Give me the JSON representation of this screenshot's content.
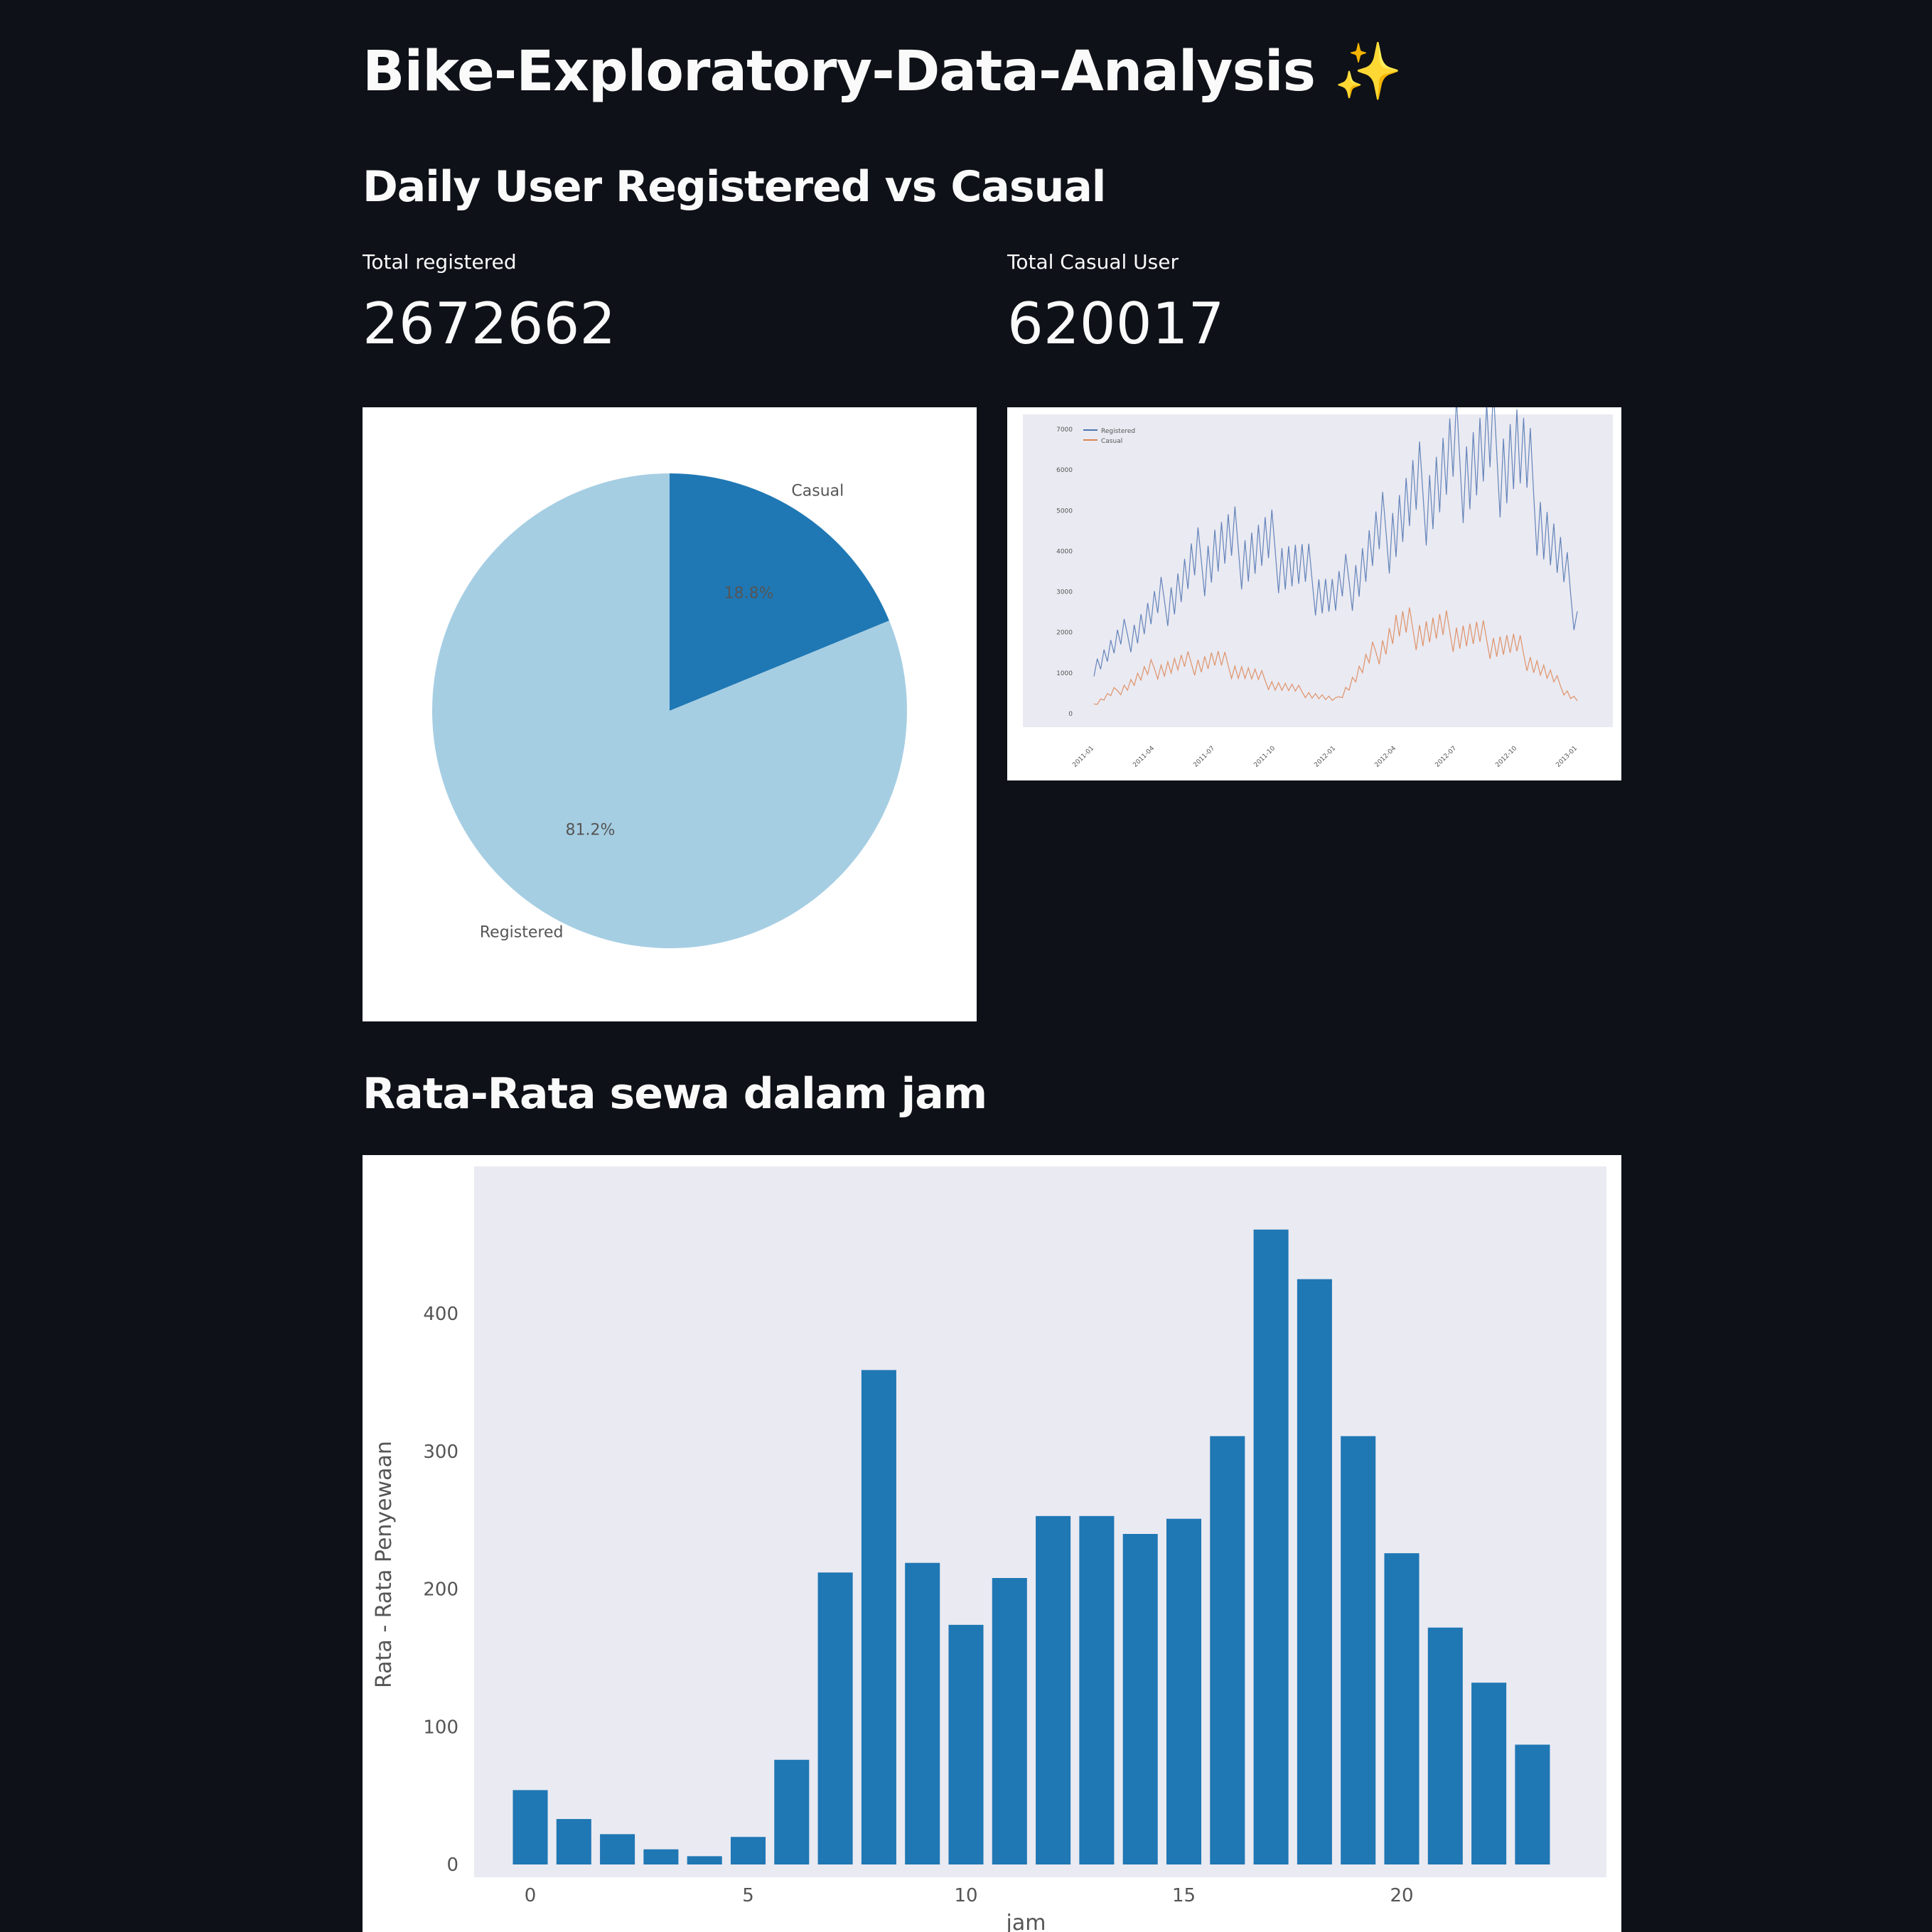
{
  "header": {
    "title": "Bike-Exploratory-Data-Analysis",
    "title_icon": "sparkles-icon",
    "sparkle_glyph": "✨"
  },
  "section_daily": {
    "heading": "Daily User Registered vs Casual"
  },
  "metrics": [
    {
      "label": "Total registered",
      "value": "2672662"
    },
    {
      "label": "Total Casual User",
      "value": "620017"
    }
  ],
  "section_hourly": {
    "heading": "Rata-Rata sewa dalam jam"
  },
  "colors": {
    "background": "#0e1117",
    "registered_pie": "#a6cee3",
    "casual_pie": "#1f78b4",
    "bar": "#1f77b4",
    "plot_bg": "#eaeaf2",
    "registered_line": "#4c72b0",
    "casual_line": "#dd8452"
  },
  "chart_data": [
    {
      "type": "pie",
      "labels": [
        "Registered",
        "Casual"
      ],
      "values": [
        81.2,
        18.8
      ],
      "value_labels": [
        "81.2%",
        "18.8%"
      ],
      "colors": [
        "#a6cee3",
        "#1f78b4"
      ]
    },
    {
      "type": "line",
      "legend": [
        "Registered",
        "Casual"
      ],
      "legend_position": "top-left",
      "x": [
        "2011-01",
        "2011-04",
        "2011-07",
        "2011-10",
        "2012-01",
        "2012-04",
        "2012-07",
        "2012-10",
        "2013-01"
      ],
      "series": [
        {
          "name": "Registered",
          "values": [
            1200,
            2500,
            4100,
            4000,
            2800,
            4800,
            6200,
            6500,
            2500
          ]
        },
        {
          "name": "Casual",
          "values": [
            200,
            1100,
            1300,
            700,
            300,
            2100,
            2000,
            1600,
            300
          ]
        }
      ],
      "ylim": [
        0,
        7000
      ]
    },
    {
      "type": "bar",
      "xlabel": "jam",
      "ylabel": "Rata - Rata Penyewaan",
      "categories": [
        0,
        1,
        2,
        3,
        4,
        5,
        6,
        7,
        8,
        9,
        10,
        11,
        12,
        13,
        14,
        15,
        16,
        17,
        18,
        19,
        20,
        21,
        22,
        23
      ],
      "values": [
        54,
        33,
        22,
        11,
        6,
        20,
        76,
        212,
        359,
        219,
        174,
        208,
        253,
        253,
        240,
        251,
        311,
        461,
        425,
        311,
        226,
        172,
        132,
        87
      ],
      "yticks": [
        0,
        100,
        200,
        300,
        400
      ],
      "xticks": [
        0,
        5,
        10,
        15,
        20
      ],
      "ylim": [
        0,
        480
      ],
      "grid": false
    }
  ]
}
